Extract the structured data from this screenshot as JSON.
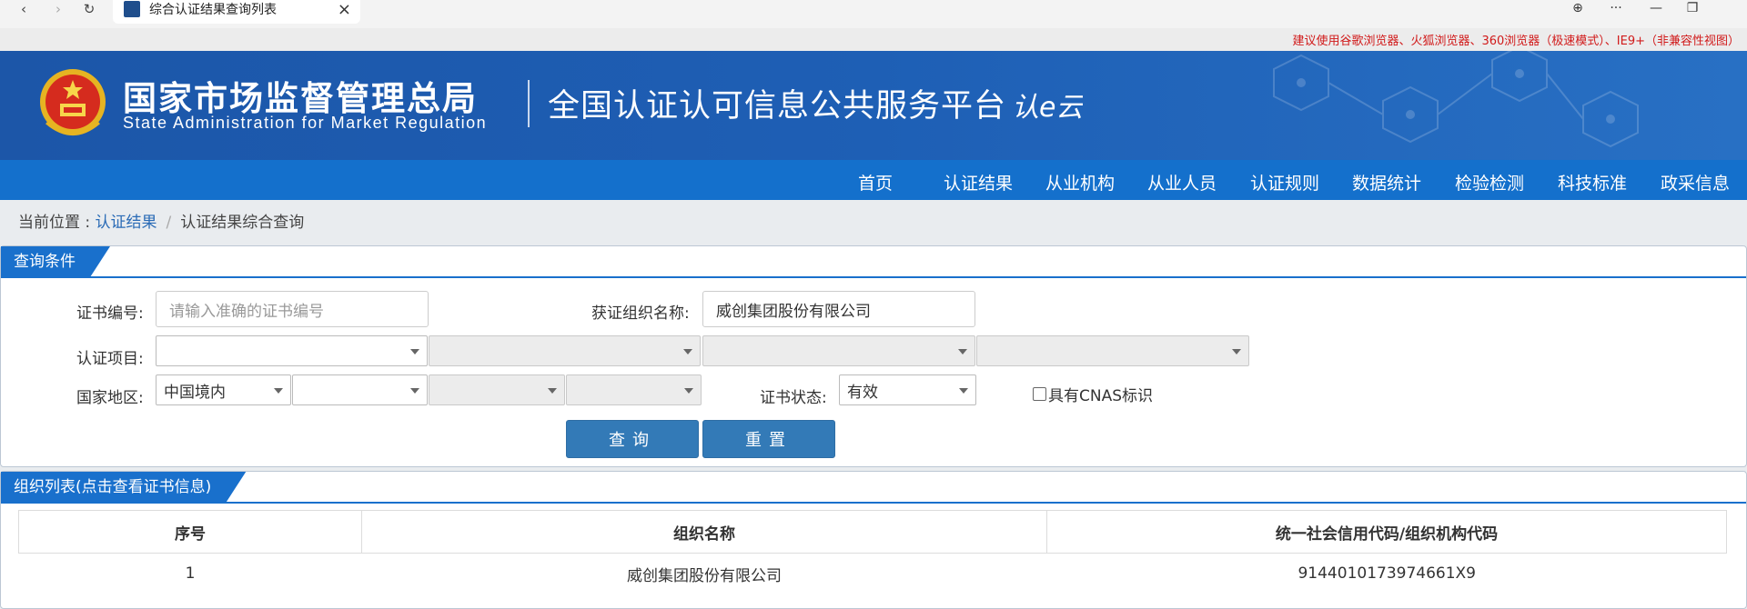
{
  "browser": {
    "tab_title": "综合认证结果查询列表",
    "tab_close": "×",
    "back": "‹",
    "forward": "›",
    "reload": "↻",
    "globe": "⊕",
    "more": "···",
    "minimize": "—",
    "restore": "❐"
  },
  "notice": "建议使用谷歌浏览器、火狐浏览器、360浏览器（极速模式）、IE9+（非兼容性视图）",
  "header": {
    "org_cn": "国家市场监督管理总局",
    "org_en": "State Administration  for  Market Regulation",
    "platform": "全国认证认可信息公共服务平台",
    "brand_text": "认e云"
  },
  "nav": [
    "首页",
    "认证结果",
    "从业机构",
    "从业人员",
    "认证规则",
    "数据统计",
    "检验检测",
    "科技标准",
    "政采信息"
  ],
  "breadcrumb": {
    "prefix": "当前位置 : ",
    "link": "认证结果",
    "sep": "/",
    "current": "认证结果综合查询"
  },
  "query": {
    "title": "查询条件",
    "cert_no_label": "证书编号:",
    "cert_no_placeholder": "请输入准确的证书编号",
    "org_name_label": "获证组织名称:",
    "org_name_value": "威创集团股份有限公司",
    "project_label": "认证项目:",
    "region_label": "国家地区:",
    "region_value": "中国境内",
    "status_label": "证书状态:",
    "status_value": "有效",
    "cnas_label": "具有CNAS标识",
    "search_button": "查询",
    "reset_button": "重置"
  },
  "results": {
    "title": "组织列表(点击查看证书信息)",
    "columns": [
      "序号",
      "组织名称",
      "统一社会信用代码/组织机构代码"
    ],
    "rows": [
      [
        "1",
        "威创集团股份有限公司",
        "9144010173974661X9"
      ]
    ]
  },
  "colors": {
    "banner_blue": "#1c56a8",
    "nav_blue": "#1470cc",
    "button_blue": "#337ab7",
    "notice_red": "#d11a1a"
  }
}
